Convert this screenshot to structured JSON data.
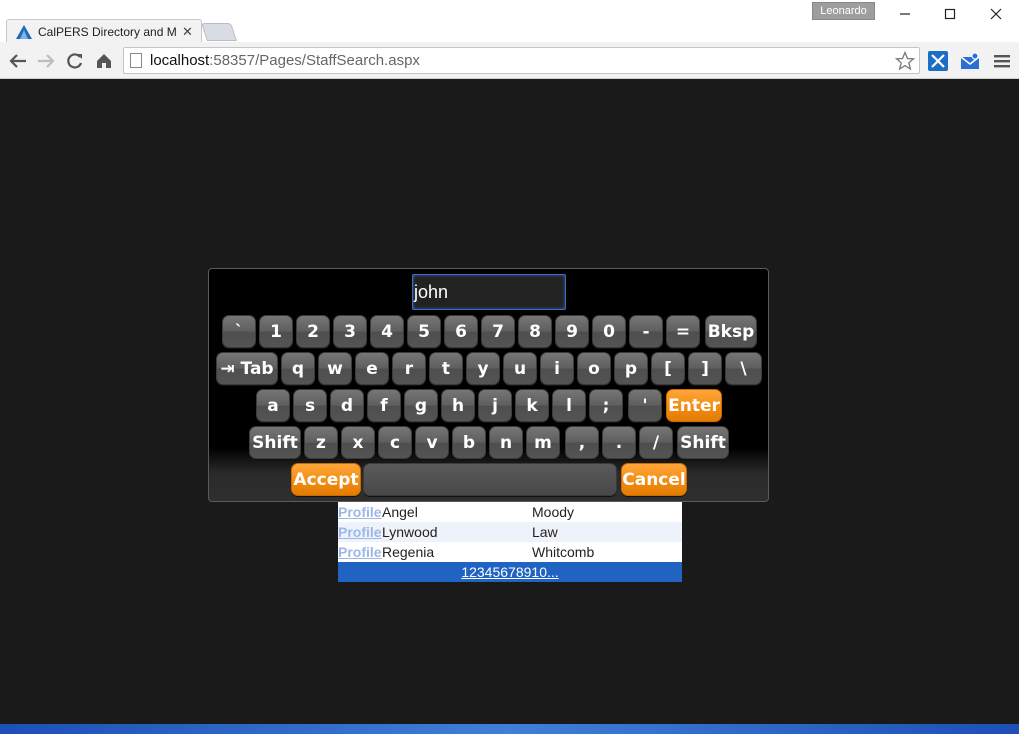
{
  "browser": {
    "tab_title": "CalPERS Directory and Ma",
    "profile_name": "Leonardo",
    "url_host": "localhost",
    "url_rest": ":58357/Pages/StaffSearch.aspx"
  },
  "keyboard": {
    "input_value": "john",
    "rows": [
      [
        "`",
        "1",
        "2",
        "3",
        "4",
        "5",
        "6",
        "7",
        "8",
        "9",
        "0",
        "-",
        "=",
        "Bksp"
      ],
      [
        "⇥ Tab",
        "q",
        "w",
        "e",
        "r",
        "t",
        "y",
        "u",
        "i",
        "o",
        "p",
        "[",
        "]",
        "\\"
      ],
      [
        "a",
        "s",
        "d",
        "f",
        "g",
        "h",
        "j",
        "k",
        "l",
        ";",
        "'",
        "Enter"
      ],
      [
        "Shift",
        "z",
        "x",
        "c",
        "v",
        "b",
        "n",
        "m",
        ",",
        ".",
        "/",
        "Shift"
      ],
      [
        "Accept",
        "",
        "Cancel"
      ]
    ]
  },
  "results": {
    "link_label": "Profile",
    "rows": [
      {
        "first": "Angel",
        "last": "Moody"
      },
      {
        "first": "Lynwood",
        "last": "Law"
      },
      {
        "first": "Regenia",
        "last": "Whitcomb"
      }
    ],
    "pager": "12345678910..."
  },
  "colors": {
    "accent_orange": "#f28a0f",
    "pager_blue": "#2163c3",
    "page_bg": "#1a1a1a"
  }
}
